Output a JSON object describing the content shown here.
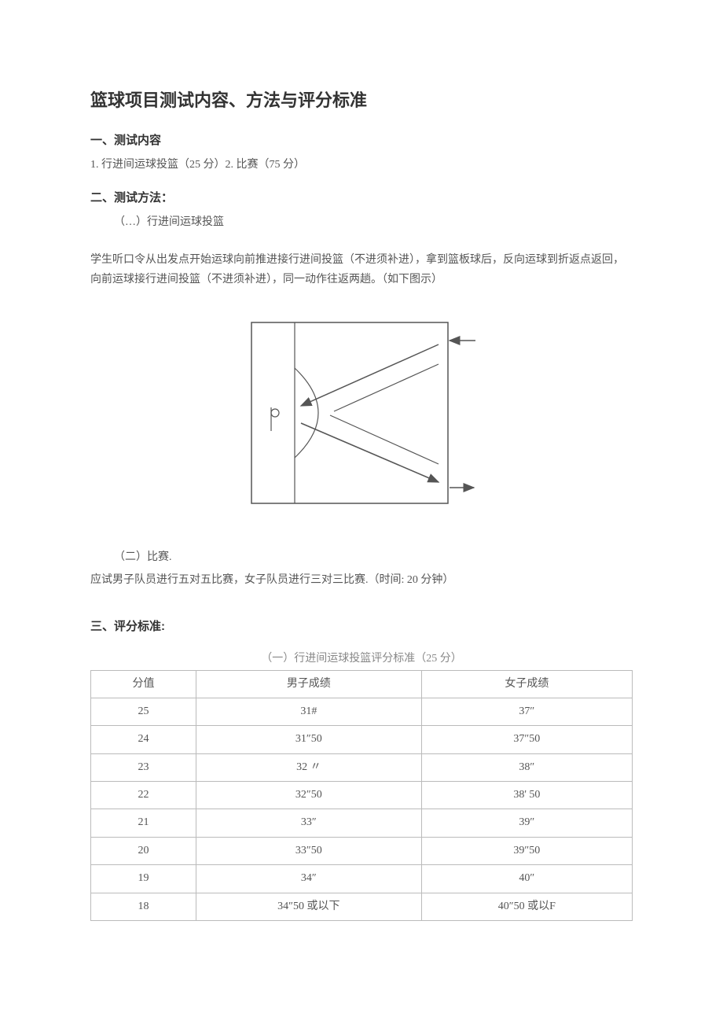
{
  "title": "篮球项目测试内容、方法与评分标准",
  "section1": {
    "heading": "一、测试内容",
    "content": "1. 行进间运球投篮（25 分）2. 比赛（75 分）"
  },
  "section2": {
    "heading": "二、测试方法：",
    "sub1": "（…）行进间运球投篮",
    "paragraph": "学生听口令从出发点开始运球向前推进接行进间投篮（不进须补进），拿到篮板球后，反向运球到折返点返回，向前运球接行进间投篮（不进须补进），同一动作往返两趟。（如下图示）",
    "sub2": "（二）比赛.",
    "matchDesc": "应试男子队员进行五对五比赛，女子队员进行三对三比赛.（时间: 20 分钟）"
  },
  "section3": {
    "heading": "三、评分标准:",
    "tableCaption": "（一）行进间运球投篮评分标准（25 分）",
    "headers": [
      "分值",
      "男子成绩",
      "女子成绩"
    ],
    "rows": [
      [
        "25",
        "31#",
        "37″"
      ],
      [
        "24",
        "31″50",
        "37″50"
      ],
      [
        "23",
        "32 〃",
        "38″"
      ],
      [
        "22",
        "32″50",
        "38' 50"
      ],
      [
        "21",
        "33″",
        "39″"
      ],
      [
        "20",
        "33″50",
        "39″50"
      ],
      [
        "19",
        "34″",
        "40″"
      ],
      [
        "18",
        "34″50 或以下",
        "40″50 或以F"
      ]
    ]
  },
  "chart_data": {
    "type": "table",
    "title": "（一）行进间运球投篮评分标准（25 分）",
    "categories": [
      "分值",
      "男子成绩",
      "女子成绩"
    ],
    "series": [
      {
        "name": "分值",
        "values": [
          25,
          24,
          23,
          22,
          21,
          20,
          19,
          18
        ]
      },
      {
        "name": "男子成绩",
        "values": [
          "31#",
          "31″50",
          "32 〃",
          "32″50",
          "33″",
          "33″50",
          "34″",
          "34″50 或以下"
        ]
      },
      {
        "name": "女子成绩",
        "values": [
          "37″",
          "37″50",
          "38″",
          "38' 50",
          "39″",
          "39″50",
          "40″",
          "40″50 或以F"
        ]
      }
    ]
  }
}
